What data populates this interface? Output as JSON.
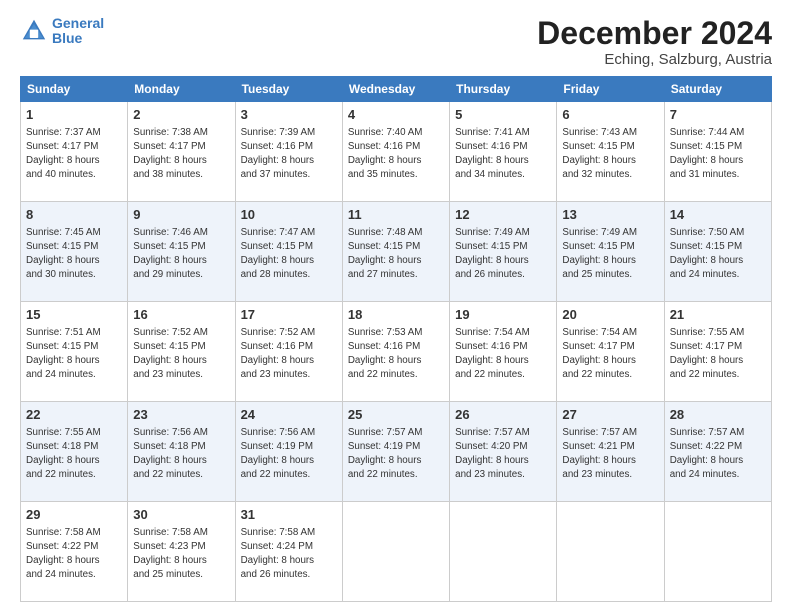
{
  "header": {
    "logo_line1": "General",
    "logo_line2": "Blue",
    "main_title": "December 2024",
    "subtitle": "Eching, Salzburg, Austria"
  },
  "columns": [
    "Sunday",
    "Monday",
    "Tuesday",
    "Wednesday",
    "Thursday",
    "Friday",
    "Saturday"
  ],
  "weeks": [
    [
      {
        "day": "1",
        "info": "Sunrise: 7:37 AM\nSunset: 4:17 PM\nDaylight: 8 hours\nand 40 minutes."
      },
      {
        "day": "2",
        "info": "Sunrise: 7:38 AM\nSunset: 4:17 PM\nDaylight: 8 hours\nand 38 minutes."
      },
      {
        "day": "3",
        "info": "Sunrise: 7:39 AM\nSunset: 4:16 PM\nDaylight: 8 hours\nand 37 minutes."
      },
      {
        "day": "4",
        "info": "Sunrise: 7:40 AM\nSunset: 4:16 PM\nDaylight: 8 hours\nand 35 minutes."
      },
      {
        "day": "5",
        "info": "Sunrise: 7:41 AM\nSunset: 4:16 PM\nDaylight: 8 hours\nand 34 minutes."
      },
      {
        "day": "6",
        "info": "Sunrise: 7:43 AM\nSunset: 4:15 PM\nDaylight: 8 hours\nand 32 minutes."
      },
      {
        "day": "7",
        "info": "Sunrise: 7:44 AM\nSunset: 4:15 PM\nDaylight: 8 hours\nand 31 minutes."
      }
    ],
    [
      {
        "day": "8",
        "info": "Sunrise: 7:45 AM\nSunset: 4:15 PM\nDaylight: 8 hours\nand 30 minutes."
      },
      {
        "day": "9",
        "info": "Sunrise: 7:46 AM\nSunset: 4:15 PM\nDaylight: 8 hours\nand 29 minutes."
      },
      {
        "day": "10",
        "info": "Sunrise: 7:47 AM\nSunset: 4:15 PM\nDaylight: 8 hours\nand 28 minutes."
      },
      {
        "day": "11",
        "info": "Sunrise: 7:48 AM\nSunset: 4:15 PM\nDaylight: 8 hours\nand 27 minutes."
      },
      {
        "day": "12",
        "info": "Sunrise: 7:49 AM\nSunset: 4:15 PM\nDaylight: 8 hours\nand 26 minutes."
      },
      {
        "day": "13",
        "info": "Sunrise: 7:49 AM\nSunset: 4:15 PM\nDaylight: 8 hours\nand 25 minutes."
      },
      {
        "day": "14",
        "info": "Sunrise: 7:50 AM\nSunset: 4:15 PM\nDaylight: 8 hours\nand 24 minutes."
      }
    ],
    [
      {
        "day": "15",
        "info": "Sunrise: 7:51 AM\nSunset: 4:15 PM\nDaylight: 8 hours\nand 24 minutes."
      },
      {
        "day": "16",
        "info": "Sunrise: 7:52 AM\nSunset: 4:15 PM\nDaylight: 8 hours\nand 23 minutes."
      },
      {
        "day": "17",
        "info": "Sunrise: 7:52 AM\nSunset: 4:16 PM\nDaylight: 8 hours\nand 23 minutes."
      },
      {
        "day": "18",
        "info": "Sunrise: 7:53 AM\nSunset: 4:16 PM\nDaylight: 8 hours\nand 22 minutes."
      },
      {
        "day": "19",
        "info": "Sunrise: 7:54 AM\nSunset: 4:16 PM\nDaylight: 8 hours\nand 22 minutes."
      },
      {
        "day": "20",
        "info": "Sunrise: 7:54 AM\nSunset: 4:17 PM\nDaylight: 8 hours\nand 22 minutes."
      },
      {
        "day": "21",
        "info": "Sunrise: 7:55 AM\nSunset: 4:17 PM\nDaylight: 8 hours\nand 22 minutes."
      }
    ],
    [
      {
        "day": "22",
        "info": "Sunrise: 7:55 AM\nSunset: 4:18 PM\nDaylight: 8 hours\nand 22 minutes."
      },
      {
        "day": "23",
        "info": "Sunrise: 7:56 AM\nSunset: 4:18 PM\nDaylight: 8 hours\nand 22 minutes."
      },
      {
        "day": "24",
        "info": "Sunrise: 7:56 AM\nSunset: 4:19 PM\nDaylight: 8 hours\nand 22 minutes."
      },
      {
        "day": "25",
        "info": "Sunrise: 7:57 AM\nSunset: 4:19 PM\nDaylight: 8 hours\nand 22 minutes."
      },
      {
        "day": "26",
        "info": "Sunrise: 7:57 AM\nSunset: 4:20 PM\nDaylight: 8 hours\nand 23 minutes."
      },
      {
        "day": "27",
        "info": "Sunrise: 7:57 AM\nSunset: 4:21 PM\nDaylight: 8 hours\nand 23 minutes."
      },
      {
        "day": "28",
        "info": "Sunrise: 7:57 AM\nSunset: 4:22 PM\nDaylight: 8 hours\nand 24 minutes."
      }
    ],
    [
      {
        "day": "29",
        "info": "Sunrise: 7:58 AM\nSunset: 4:22 PM\nDaylight: 8 hours\nand 24 minutes."
      },
      {
        "day": "30",
        "info": "Sunrise: 7:58 AM\nSunset: 4:23 PM\nDaylight: 8 hours\nand 25 minutes."
      },
      {
        "day": "31",
        "info": "Sunrise: 7:58 AM\nSunset: 4:24 PM\nDaylight: 8 hours\nand 26 minutes."
      },
      null,
      null,
      null,
      null
    ]
  ]
}
